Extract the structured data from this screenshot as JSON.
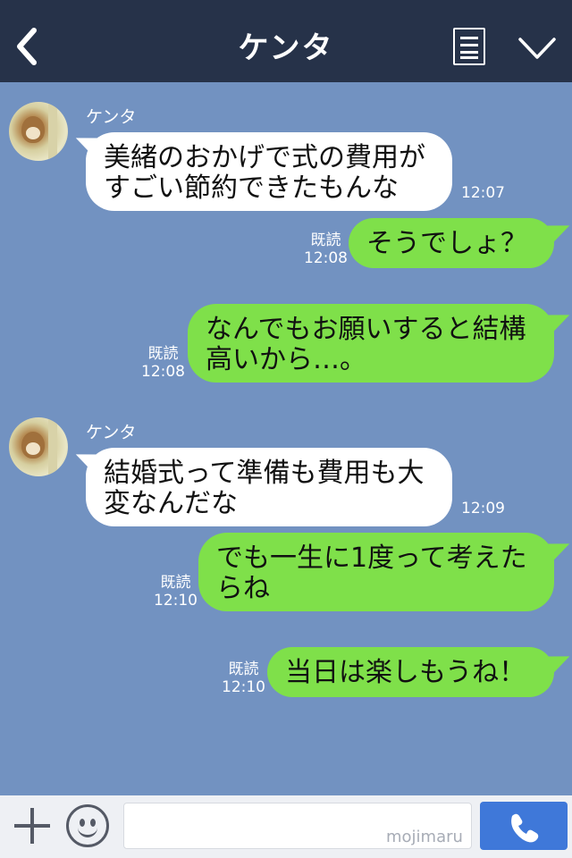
{
  "header": {
    "title": "ケンタ",
    "back_icon": "chevron-left-icon",
    "menu_icon": "list-icon",
    "collapse_icon": "chevron-down-icon"
  },
  "messages": [
    {
      "direction": "in",
      "sender": "ケンタ",
      "lines": [
        "美緒のおかげで式の費用が",
        "すごい節約できたもんな"
      ],
      "time": "12:07"
    },
    {
      "direction": "out",
      "lines": [
        "そうでしょ？"
      ],
      "read": "既読",
      "time": "12:08"
    },
    {
      "direction": "out",
      "lines": [
        "なんでもお願いすると結構",
        "高いから…。"
      ],
      "read": "既読",
      "time": "12:08"
    },
    {
      "direction": "in",
      "sender": "ケンタ",
      "lines": [
        "結婚式って準備も費用も大",
        "変なんだな"
      ],
      "time": "12:09"
    },
    {
      "direction": "out",
      "lines": [
        "でも一生に1度って考えた",
        "らね"
      ],
      "read": "既読",
      "time": "12:10"
    },
    {
      "direction": "out",
      "lines": [
        "当日は楽しもうね！"
      ],
      "read": "既読",
      "time": "12:10"
    }
  ],
  "footer": {
    "plus_icon": "plus-icon",
    "emoji_icon": "smiley-icon",
    "call_icon": "phone-icon",
    "watermark": "mojimaru"
  },
  "colors": {
    "header_bg": "#263249",
    "chat_bg": "#7292c1",
    "incoming_bubble": "#ffffff",
    "outgoing_bubble": "#7fe04a",
    "call_button": "#3f78d9"
  }
}
